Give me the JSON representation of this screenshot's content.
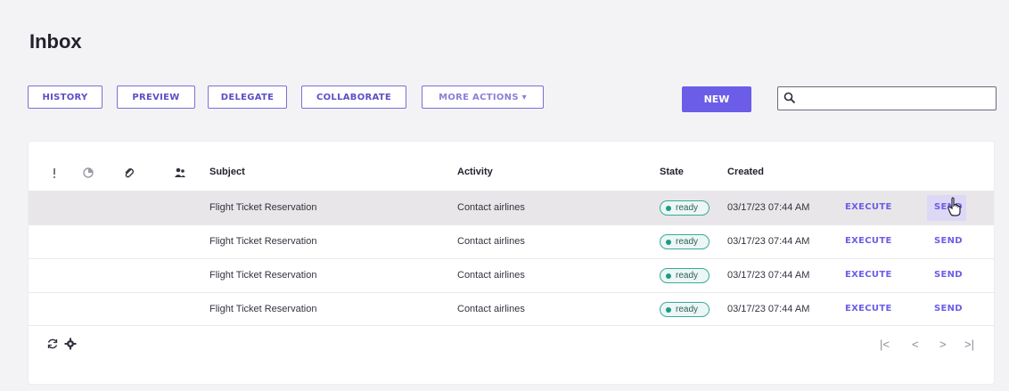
{
  "page": {
    "title": "Inbox"
  },
  "toolbar": {
    "history": "HISTORY",
    "preview": "PREVIEW",
    "delegate": "DELEGATE",
    "collaborate": "COLLABORATE",
    "more_actions": "MORE ACTIONS ▾",
    "new": "NEW"
  },
  "search": {
    "value": "",
    "placeholder": ""
  },
  "table": {
    "headers": {
      "priority": "!",
      "subject": "Subject",
      "activity": "Activity",
      "state": "State",
      "created": "Created"
    },
    "rows": [
      {
        "subject": "Flight Ticket Reservation",
        "activity": "Contact airlines",
        "state": "ready",
        "created": "03/17/23 07:44 AM",
        "execute": "EXECUTE",
        "send": "SEND"
      },
      {
        "subject": "Flight Ticket Reservation",
        "activity": "Contact airlines",
        "state": "ready",
        "created": "03/17/23 07:44 AM",
        "execute": "EXECUTE",
        "send": "SEND"
      },
      {
        "subject": "Flight Ticket Reservation",
        "activity": "Contact airlines",
        "state": "ready",
        "created": "03/17/23 07:44 AM",
        "execute": "EXECUTE",
        "send": "SEND"
      },
      {
        "subject": "Flight Ticket Reservation",
        "activity": "Contact airlines",
        "state": "ready",
        "created": "03/17/23 07:44 AM",
        "execute": "EXECUTE",
        "send": "SEND"
      }
    ]
  },
  "pager": {
    "first": "|<",
    "prev": "<",
    "next": ">",
    "last": ">|"
  },
  "colors": {
    "accent": "#6b5de8",
    "ready": "#1f9a86",
    "row_highlight": "#e9e6e9"
  },
  "icons": [
    "priority-icon",
    "progress-icon",
    "attachment-icon",
    "people-icon",
    "search-icon",
    "refresh-icon",
    "settings-icon",
    "first-page-icon",
    "prev-page-icon",
    "next-page-icon",
    "last-page-icon",
    "hand-cursor-icon"
  ]
}
